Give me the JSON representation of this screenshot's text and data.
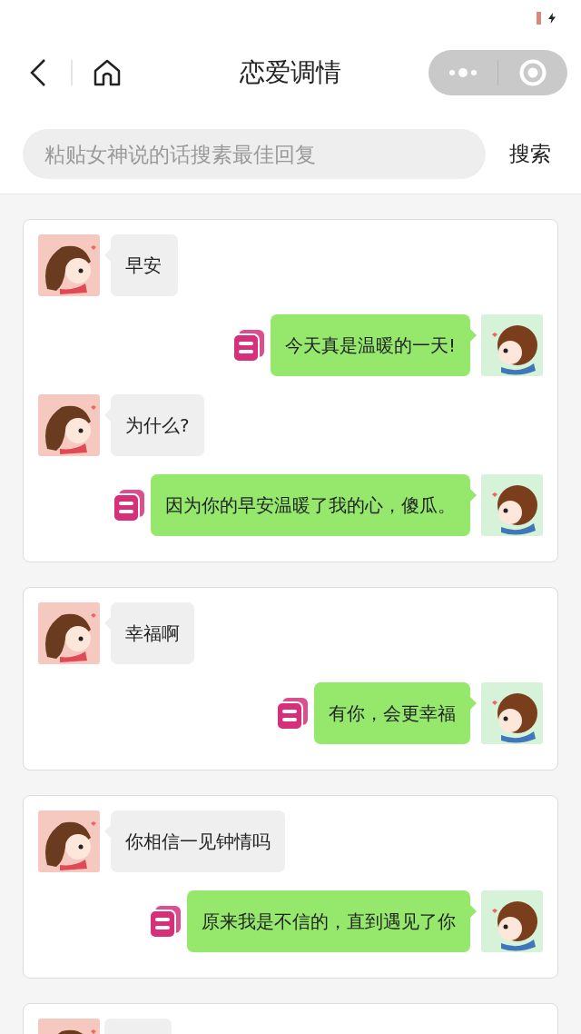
{
  "nav": {
    "title": "恋爱调情"
  },
  "search": {
    "placeholder": "粘贴女神说的话搜素最佳回复",
    "button": "搜索"
  },
  "cards": [
    {
      "messages": [
        {
          "kind": "received",
          "text": "早安"
        },
        {
          "kind": "sent",
          "text": "今天真是温暖的一天!"
        },
        {
          "kind": "received",
          "text": "为什么?"
        },
        {
          "kind": "sent",
          "text": "因为你的早安温暖了我的心，傻瓜。"
        }
      ]
    },
    {
      "messages": [
        {
          "kind": "received",
          "text": "幸福啊"
        },
        {
          "kind": "sent",
          "text": "有你，会更幸福"
        }
      ]
    },
    {
      "messages": [
        {
          "kind": "received",
          "text": "你相信一见钟情吗"
        },
        {
          "kind": "sent",
          "text": "原来我是不信的，直到遇见了你"
        }
      ]
    },
    {
      "messages": [
        {
          "kind": "received"
        }
      ]
    }
  ]
}
